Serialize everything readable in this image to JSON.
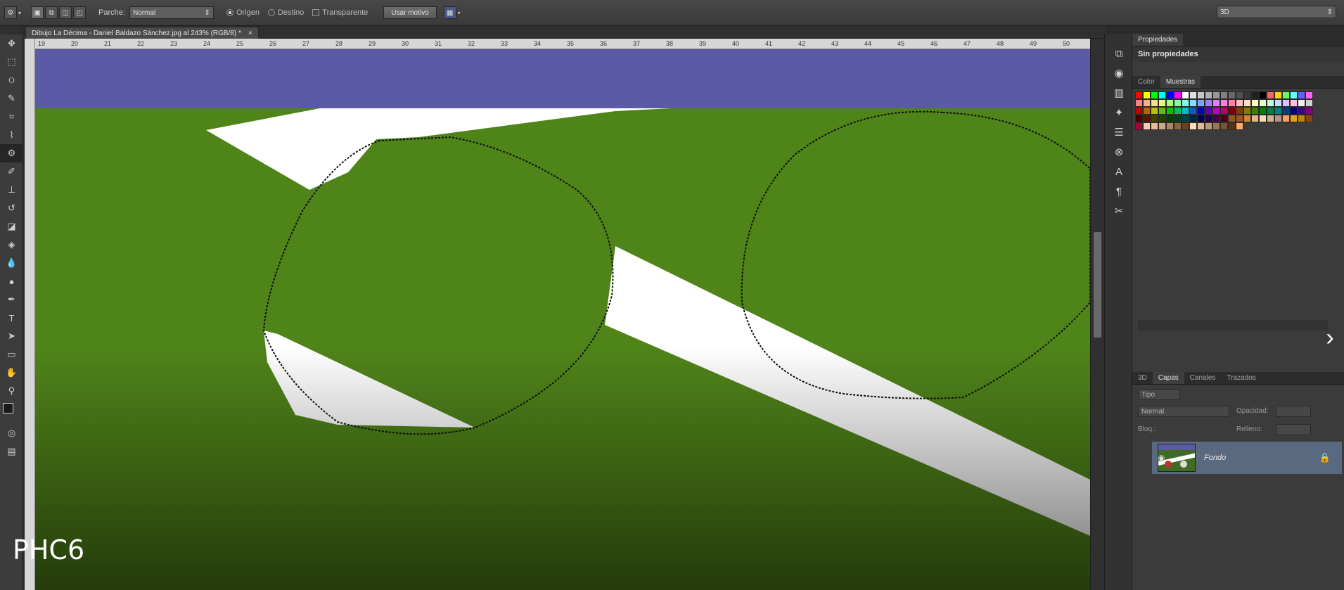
{
  "options_bar": {
    "tool_icon": "patch-tool-icon",
    "patch_label": "Parche:",
    "patch_mode": "Normal",
    "origin_label": "Origen",
    "destination_label": "Destino",
    "transparent_label": "Transparente",
    "use_pattern_button": "Usar motivo",
    "workspace": "3D"
  },
  "document": {
    "tab_title": "Dibujo La Décima - Daniel Baldazo Sánchez.jpg al 243% (RGB/8) *",
    "close_symbol": "×",
    "ruler_top_numbers": [
      "19",
      "20",
      "21",
      "22",
      "23",
      "24",
      "25",
      "26",
      "27",
      "28",
      "29",
      "30",
      "31",
      "32",
      "33",
      "34",
      "35",
      "36",
      "37",
      "38",
      "39",
      "40",
      "41",
      "42",
      "43",
      "44",
      "45",
      "46",
      "47",
      "48",
      "49",
      "50"
    ]
  },
  "tools": [
    "move-icon",
    "marquee-icon",
    "lasso-icon",
    "quick-select-icon",
    "crop-icon",
    "eyedropper-icon",
    "patch-tool-icon",
    "brush-icon",
    "stamp-icon",
    "history-brush-icon",
    "eraser-icon",
    "paint-bucket-icon",
    "blur-icon",
    "dodge-icon",
    "pen-icon",
    "type-icon",
    "path-select-icon",
    "shape-icon",
    "hand-icon",
    "zoom-icon"
  ],
  "panels": {
    "properties_tab": "Propiedades",
    "properties_title": "Sin propiedades",
    "color_tab": "Color",
    "swatches_tab": "Muestras",
    "layers_tabs": [
      "3D",
      "Capas",
      "Canales",
      "Trazados"
    ],
    "kind_filter": "Tipo",
    "blend_mode": "Normal",
    "opacity_label": "Opacidad:",
    "lock_label": "Bloq.:",
    "fill_label": "Relleno:",
    "layer_name": "Fondo"
  },
  "colors": {
    "sky": "#5a5aa6",
    "grass": "#4f8419",
    "line": "#ffffff",
    "layer_highlight": "#596a80"
  },
  "overlay": {
    "watermark": "PHC6",
    "next_icon": "chevron-right-icon"
  }
}
